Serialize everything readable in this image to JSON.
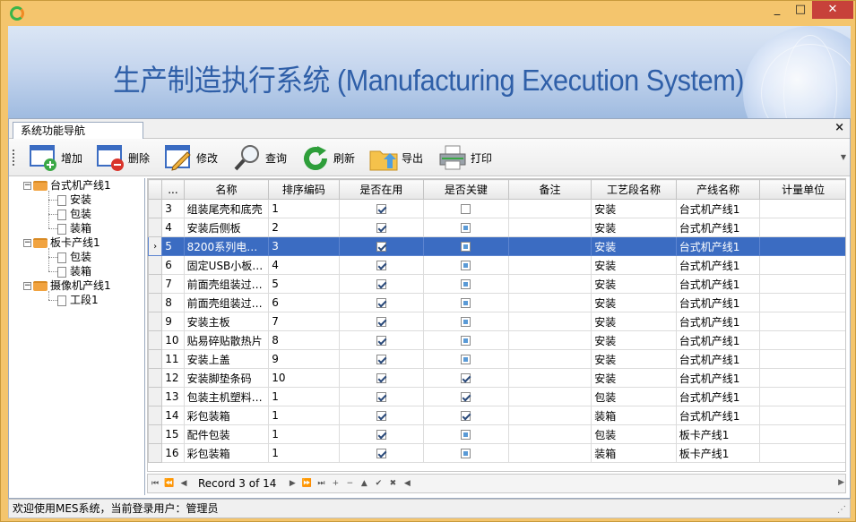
{
  "window": {
    "min": "_",
    "max": "□",
    "close": "✕"
  },
  "banner": {
    "title": "生产制造执行系统 (Manufacturing Execution System)"
  },
  "nav_panel": {
    "tab": "系统功能导航",
    "close": "×"
  },
  "toolbar": {
    "add": "增加",
    "delete": "删除",
    "edit": "修改",
    "query": "查询",
    "refresh": "刷新",
    "export": "导出",
    "print": "打印"
  },
  "tree": [
    {
      "label": "台式机产线1",
      "children": [
        "安装",
        "包装",
        "装箱"
      ]
    },
    {
      "label": "板卡产线1",
      "children": [
        "包装",
        "装箱"
      ]
    },
    {
      "label": "摄像机产线1",
      "children": [
        "工段1"
      ]
    }
  ],
  "grid": {
    "columns": [
      "...",
      "名称",
      "排序编码",
      "是否在用",
      "是否关键",
      "备注",
      "工艺段名称",
      "产线名称",
      "计量单位"
    ],
    "rows": [
      {
        "id": "3",
        "name": "组装尾壳和底壳",
        "sort": "1",
        "inuse": true,
        "key": "off",
        "note": "",
        "stage": "安装",
        "line": "台式机产线1",
        "unit": ""
      },
      {
        "id": "4",
        "name": "安装后侧板",
        "sort": "2",
        "inuse": true,
        "key": "ind",
        "note": "",
        "stage": "安装",
        "line": "台式机产线1",
        "unit": ""
      },
      {
        "id": "5",
        "name": "8200系列电…",
        "sort": "3",
        "inuse": true,
        "key": "ind",
        "note": "",
        "stage": "安装",
        "line": "台式机产线1",
        "unit": "",
        "selected": true
      },
      {
        "id": "6",
        "name": "固定USB小板…",
        "sort": "4",
        "inuse": true,
        "key": "ind",
        "note": "",
        "stage": "安装",
        "line": "台式机产线1",
        "unit": ""
      },
      {
        "id": "7",
        "name": "前面壳组装过…",
        "sort": "5",
        "inuse": true,
        "key": "ind",
        "note": "",
        "stage": "安装",
        "line": "台式机产线1",
        "unit": ""
      },
      {
        "id": "8",
        "name": "前面壳组装过…",
        "sort": "6",
        "inuse": true,
        "key": "ind",
        "note": "",
        "stage": "安装",
        "line": "台式机产线1",
        "unit": ""
      },
      {
        "id": "9",
        "name": "安装主板",
        "sort": "7",
        "inuse": true,
        "key": "ind",
        "note": "",
        "stage": "安装",
        "line": "台式机产线1",
        "unit": ""
      },
      {
        "id": "10",
        "name": "贴易碎贴散热片",
        "sort": "8",
        "inuse": true,
        "key": "ind",
        "note": "",
        "stage": "安装",
        "line": "台式机产线1",
        "unit": ""
      },
      {
        "id": "11",
        "name": "安装上盖",
        "sort": "9",
        "inuse": true,
        "key": "ind",
        "note": "",
        "stage": "安装",
        "line": "台式机产线1",
        "unit": ""
      },
      {
        "id": "12",
        "name": "安装脚垫条码",
        "sort": "10",
        "inuse": true,
        "key": "on",
        "note": "",
        "stage": "安装",
        "line": "台式机产线1",
        "unit": ""
      },
      {
        "id": "13",
        "name": "包装主机塑料…",
        "sort": "1",
        "inuse": true,
        "key": "on",
        "note": "",
        "stage": "包装",
        "line": "台式机产线1",
        "unit": ""
      },
      {
        "id": "14",
        "name": "彩包装箱",
        "sort": "1",
        "inuse": true,
        "key": "on",
        "note": "",
        "stage": "装箱",
        "line": "台式机产线1",
        "unit": ""
      },
      {
        "id": "15",
        "name": "配件包装",
        "sort": "1",
        "inuse": true,
        "key": "ind",
        "note": "",
        "stage": "包装",
        "line": "板卡产线1",
        "unit": ""
      },
      {
        "id": "16",
        "name": "彩包装箱",
        "sort": "1",
        "inuse": true,
        "key": "ind",
        "note": "",
        "stage": "装箱",
        "line": "板卡产线1",
        "unit": ""
      }
    ]
  },
  "navigator": {
    "record": "Record 3 of 14"
  },
  "status": {
    "text": "欢迎使用MES系统，当前登录用户：管理员"
  }
}
